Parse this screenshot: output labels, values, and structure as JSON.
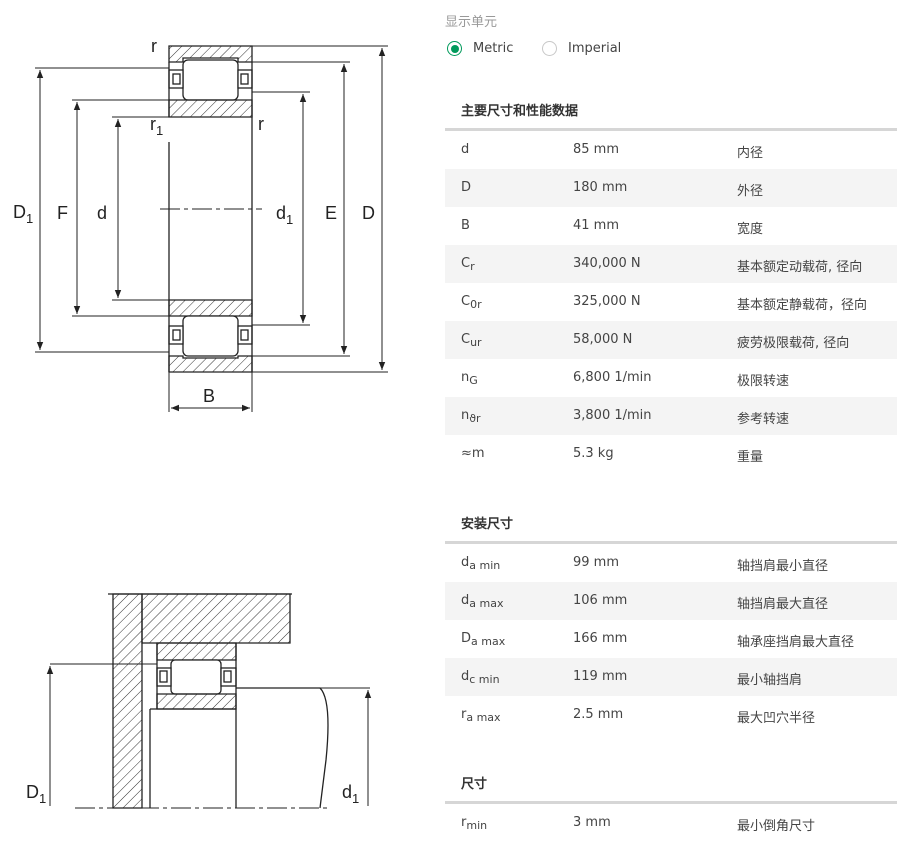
{
  "drawing_labels": {
    "r_top": "r",
    "r1": "r",
    "r1_sub": "1",
    "r_right": "r",
    "D1": "D",
    "D1_sub": "1",
    "F": "F",
    "d": "d",
    "d1": "d",
    "d1_sub": "1",
    "E": "E",
    "D": "D",
    "B": "B",
    "mount_D1": "D",
    "mount_D1_sub": "1",
    "mount_d1": "d",
    "mount_d1_sub": "1"
  },
  "units": {
    "label": "显示单元",
    "options": [
      {
        "label": "Metric",
        "checked": true
      },
      {
        "label": "Imperial",
        "checked": false
      }
    ]
  },
  "sections": [
    {
      "title": "主要尺寸和性能数据",
      "rows": [
        {
          "sym": "d",
          "sub": "",
          "value": "85 mm",
          "desc": "内径"
        },
        {
          "sym": "D",
          "sub": "",
          "value": "180 mm",
          "desc": "外径"
        },
        {
          "sym": "B",
          "sub": "",
          "value": "41 mm",
          "desc": "宽度"
        },
        {
          "sym": "C",
          "sub": "r",
          "value": "340,000 N",
          "desc": "基本额定动载荷, 径向"
        },
        {
          "sym": "C",
          "sub": "0r",
          "value": "325,000 N",
          "desc": "基本额定静载荷，径向"
        },
        {
          "sym": "C",
          "sub": "ur",
          "value": "58,000 N",
          "desc": "疲劳极限载荷, 径向"
        },
        {
          "sym": "n",
          "sub": "G",
          "value": "6,800 1/min",
          "desc": "极限转速"
        },
        {
          "sym": "n",
          "sub": "ϑr",
          "value": "3,800 1/min",
          "desc": "参考转速"
        },
        {
          "sym": "≈m",
          "sub": "",
          "value": "5.3 kg",
          "desc": "重量"
        }
      ]
    },
    {
      "title": "安装尺寸",
      "rows": [
        {
          "sym": "d",
          "sub": "a min",
          "value": "99 mm",
          "desc": "轴挡肩最小直径"
        },
        {
          "sym": "d",
          "sub": "a max",
          "value": "106 mm",
          "desc": "轴挡肩最大直径"
        },
        {
          "sym": "D",
          "sub": "a max",
          "value": "166 mm",
          "desc": "轴承座挡肩最大直径"
        },
        {
          "sym": "d",
          "sub": "c min",
          "value": "119 mm",
          "desc": "最小轴挡肩"
        },
        {
          "sym": "r",
          "sub": "a max",
          "value": "2.5 mm",
          "desc": "最大凹穴半径"
        }
      ]
    },
    {
      "title": "尺寸",
      "rows": [
        {
          "sym": "r",
          "sub": "min",
          "value": "3 mm",
          "desc": "最小倒角尺寸"
        }
      ]
    }
  ]
}
